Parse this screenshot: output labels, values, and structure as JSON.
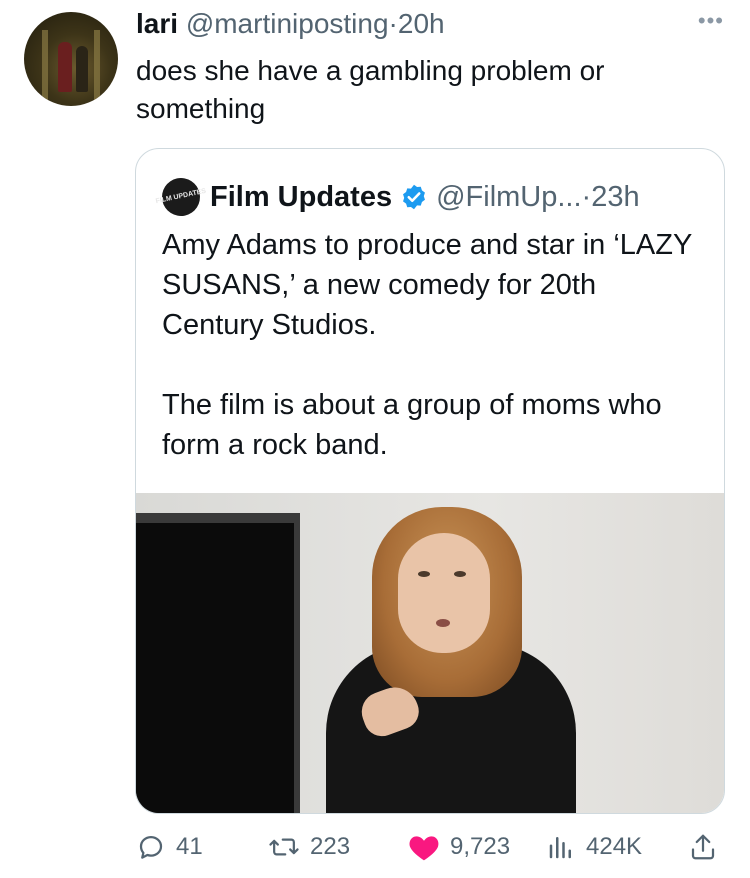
{
  "tweet": {
    "author_name": "lari",
    "handle": "@martiniposting",
    "separator": "·",
    "time": "20h",
    "text": "does she have a gambling problem or something"
  },
  "quoted": {
    "avatar_text": "FILM UPDATES",
    "author_name": "Film Updates",
    "handle": "@FilmUp...",
    "separator": "·",
    "time": "23h",
    "paragraph_1": "Amy Adams to produce and star in ‘LAZY SUSANS,’ a new comedy for 20th Century Studios.",
    "paragraph_2": "The film is about a group of moms who form a rock band."
  },
  "actions": {
    "replies": "41",
    "reposts": "223",
    "likes": "9,723",
    "views": "424K"
  },
  "icons": {
    "more": "more-icon",
    "verified": "verified-badge-icon",
    "reply": "reply-icon",
    "repost": "repost-icon",
    "like": "heart-icon",
    "views": "views-chart-icon",
    "share": "share-icon"
  },
  "colors": {
    "verified": "#1d9bf0",
    "like_active": "#f91880",
    "secondary_text": "#536471",
    "border": "#cfd9de"
  }
}
